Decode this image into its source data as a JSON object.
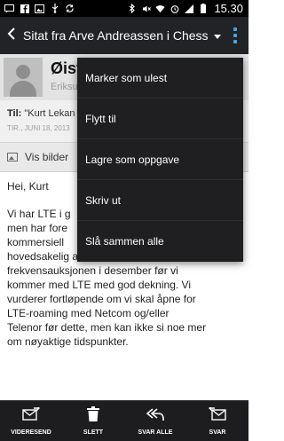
{
  "status_bar": {
    "left_icons": [
      "message-icon",
      "facebook-icon",
      "photo-icon",
      "usb-icon",
      "sync-icon"
    ],
    "right_icons": [
      "bluetooth-icon",
      "mute-icon",
      "wifi-icon",
      "alarm-icon",
      "signal-icon",
      "battery-icon"
    ],
    "time": "15.30"
  },
  "action_bar": {
    "title": "Sitat fra Arve Andreassen i Chess"
  },
  "sender": {
    "name": "Øiste",
    "subtitle": "Eriksu"
  },
  "recipients": {
    "to_label": "Til:",
    "to_value": "\"Kurt Lekan",
    "date": "TIR., JUNI 18, 2013"
  },
  "show_images": {
    "label": "Vis bilder"
  },
  "body": {
    "greeting": "Hei, Kurt",
    "paragraph": "Vi har LTE i g\nmen har fore\nkommersiell\nhovedsakelig at vi avventer\nfrekvensauksjonen i desember før vi\nkommer med LTE med god dekning. Vi\nvurderer fortløpende om vi skal åpne for\nLTE-roaming med Netcom og/eller\nTelenor før dette, men kan ikke si noe mer\nom nøyaktige tidspunkter."
  },
  "menu": {
    "items": [
      "Marker som ulest",
      "Flytt til",
      "Lagre som oppgave",
      "Skriv ut",
      "Slå sammen alle"
    ]
  },
  "bottom_bar": {
    "forward": "VIDERESEND",
    "delete": "SLETT",
    "reply_all": "SVAR ALLE",
    "reply": "SVAR"
  },
  "colors": {
    "accent": "#3ea9e6",
    "action_bar": "#222326",
    "menu_bg": "#1f1f21",
    "bottom_bar": "#1d1d1f"
  }
}
